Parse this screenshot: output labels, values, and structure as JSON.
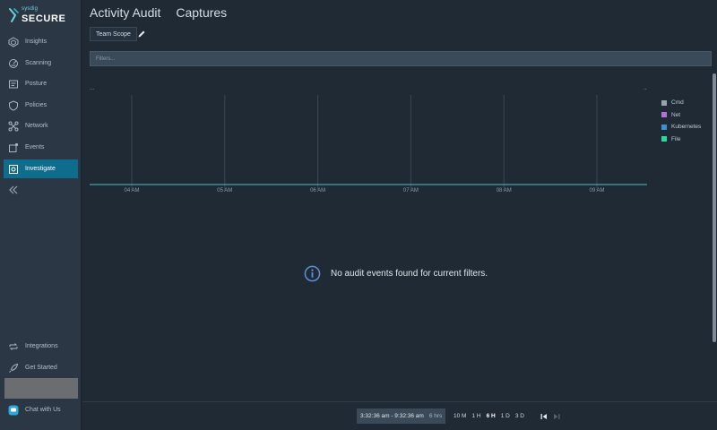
{
  "brand": {
    "small": "sysdig",
    "big": "SECURE"
  },
  "sidebar": {
    "items": [
      {
        "label": "Insights"
      },
      {
        "label": "Scanning"
      },
      {
        "label": "Posture"
      },
      {
        "label": "Policies"
      },
      {
        "label": "Network"
      },
      {
        "label": "Events"
      },
      {
        "label": "Investigate"
      }
    ],
    "bottom": [
      {
        "label": "Integrations"
      },
      {
        "label": "Get Started"
      },
      {
        "label": "Chat with Us"
      }
    ]
  },
  "tabs": [
    {
      "label": "Activity Audit"
    },
    {
      "label": "Captures"
    }
  ],
  "scope_button": "Team Scope",
  "filter": {
    "placeholder": "Filters..."
  },
  "chart": {
    "corner_left": "...",
    "corner_right": "...",
    "ticks": [
      "04 AM",
      "05 AM",
      "06 AM",
      "07 AM",
      "08 AM",
      "09 AM"
    ],
    "legend": [
      {
        "label": "Cmd",
        "color": "#9aa3ab"
      },
      {
        "label": "Net",
        "color": "#b272d6"
      },
      {
        "label": "Kubernetes",
        "color": "#3a8fd6"
      },
      {
        "label": "File",
        "color": "#2fd6a4"
      }
    ],
    "baseline_color": "#3fc7c0"
  },
  "chart_data": {
    "type": "line",
    "x": [
      "04 AM",
      "05 AM",
      "06 AM",
      "07 AM",
      "08 AM",
      "09 AM"
    ],
    "series": [
      {
        "name": "Cmd",
        "values": [
          0,
          0,
          0,
          0,
          0,
          0
        ]
      },
      {
        "name": "Net",
        "values": [
          0,
          0,
          0,
          0,
          0,
          0
        ]
      },
      {
        "name": "Kubernetes",
        "values": [
          0,
          0,
          0,
          0,
          0,
          0
        ]
      },
      {
        "name": "File",
        "values": [
          0,
          0,
          0,
          0,
          0,
          0
        ]
      }
    ],
    "legend_placement": "right"
  },
  "empty_message": "No audit events found for current filters.",
  "time_range": {
    "range": "3:32:36 am - 9:32:36 am",
    "duration": "6 hrs"
  },
  "presets": [
    {
      "label": "10 M"
    },
    {
      "label": "1 H"
    },
    {
      "label": "6 H",
      "selected": true
    },
    {
      "label": "1 D"
    },
    {
      "label": "3 D"
    }
  ]
}
